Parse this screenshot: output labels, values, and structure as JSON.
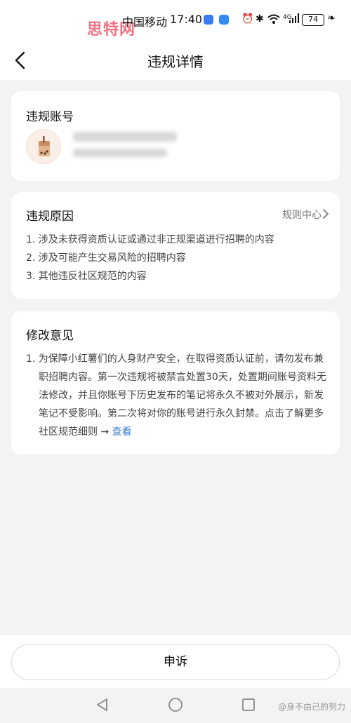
{
  "status_bar": {
    "watermark": "思特网",
    "carrier": "中国移动",
    "time": "17:40",
    "signal_label": "4G",
    "battery": "74"
  },
  "header": {
    "title": "违规详情"
  },
  "account_card": {
    "title": "违规账号"
  },
  "reason_card": {
    "title": "违规原因",
    "rules_link": "规则中心",
    "items": [
      "1. 涉及未获得资质认证或通过非正规渠道进行招聘的内容",
      "2. 涉及可能产生交易风险的招聘内容",
      "3. 其他违反社区规范的内容"
    ]
  },
  "advice_card": {
    "title": "修改意见",
    "text": "1. 为保障小红薯们的人身财产安全，在取得资质认证前，请勿发布兼职招聘内容。第一次违规将被禁言处置30天，处置期间账号资料无法修改，并且你账号下历史发布的笔记将永久不被对外展示，新发笔记不受影响。第二次将对你的账号进行永久封禁。点击了解更多社区规范细则 → ",
    "link": "查看"
  },
  "bottom": {
    "appeal_button": "申诉"
  },
  "overlay": {
    "weibo_watermark": "@身不由己的努力"
  },
  "colors": {
    "link": "#3b7cd6",
    "page_bg": "#f3f3f5",
    "watermark": "#ef5a6d"
  },
  "icons": [
    "back-arrow-icon",
    "chevron-right-icon",
    "avatar-drink-icon",
    "nav-back-icon",
    "nav-home-icon",
    "nav-recents-icon"
  ]
}
